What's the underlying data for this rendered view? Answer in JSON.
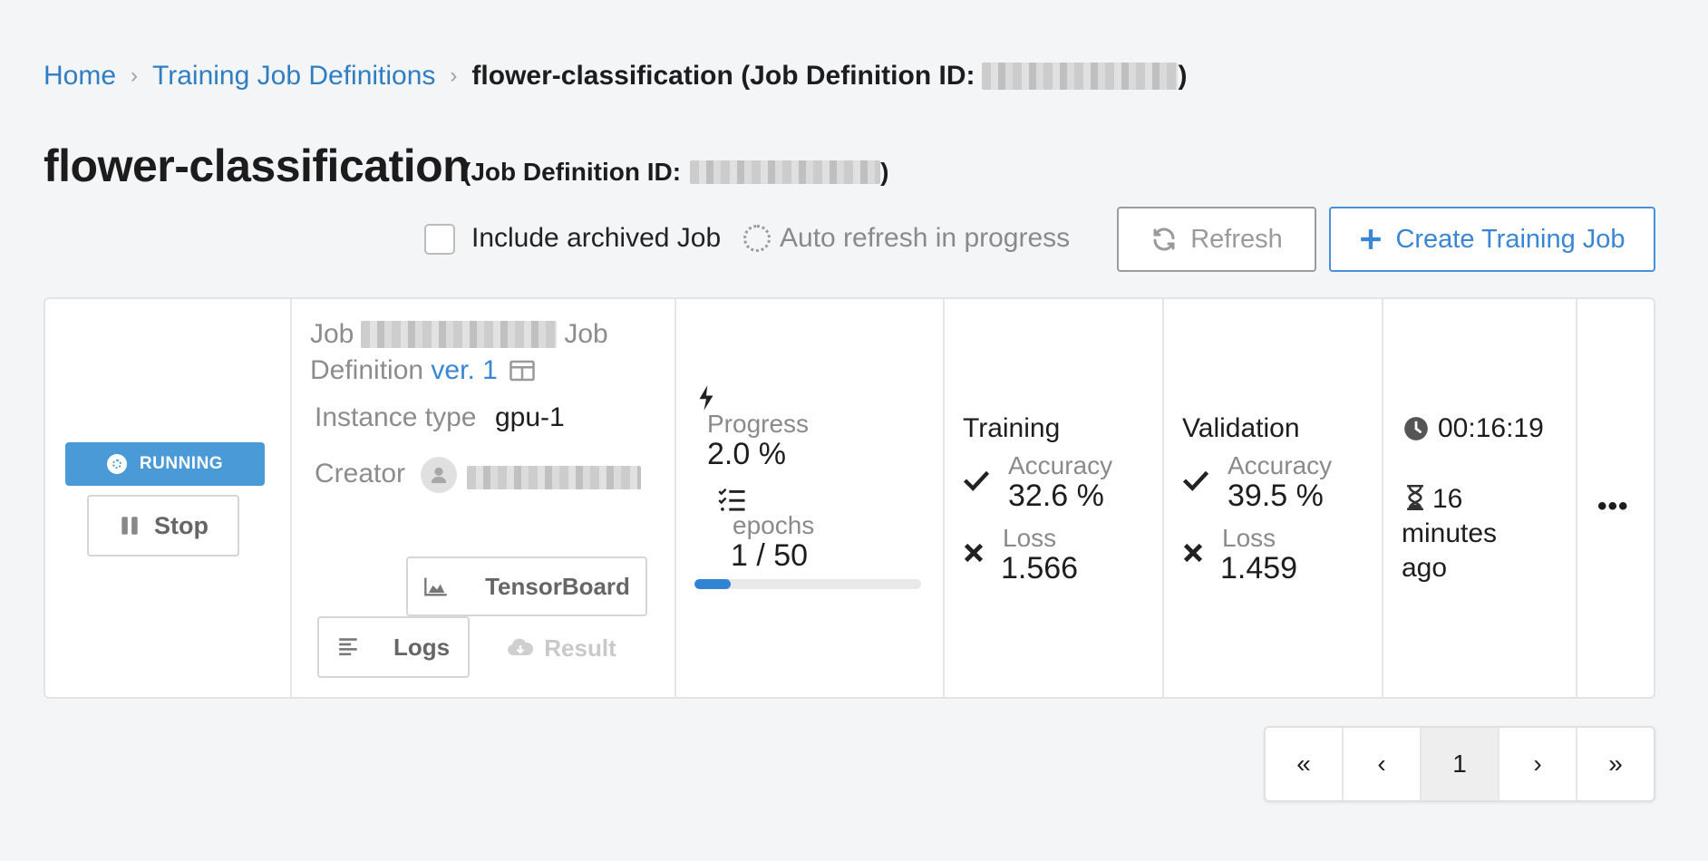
{
  "breadcrumb": {
    "home": "Home",
    "definitions": "Training Job Definitions",
    "current_name": "flower-classification",
    "current_id_prefix": "(Job Definition ID:",
    "current_id_suffix": ")"
  },
  "page": {
    "title": "flower-classification",
    "id_prefix": "(Job Definition ID:",
    "id_suffix": ")"
  },
  "toolbar": {
    "include_archived_label": "Include archived Job",
    "auto_refresh_label": "Auto refresh in progress",
    "refresh_label": "Refresh",
    "create_label": "Create Training Job"
  },
  "job": {
    "status": "RUNNING",
    "stop_label": "Stop",
    "job_prefix": "Job",
    "job_suffix": "Job",
    "definition_label": "Definition",
    "version_label": "ver. 1",
    "instance_type_label": "Instance type",
    "instance_type_value": "gpu-1",
    "creator_label": "Creator",
    "tensorboard_label": "TensorBoard",
    "logs_label": "Logs",
    "result_label": "Result",
    "progress_label": "Progress",
    "progress_value": "2.0 %",
    "progress_fraction": 0.02,
    "epochs_label": "epochs",
    "epochs_value": "1 / 50",
    "training": {
      "title": "Training",
      "accuracy_label": "Accuracy",
      "accuracy_value": "32.6 %",
      "loss_label": "Loss",
      "loss_value": "1.566"
    },
    "validation": {
      "title": "Validation",
      "accuracy_label": "Accuracy",
      "accuracy_value": "39.5 %",
      "loss_label": "Loss",
      "loss_value": "1.459"
    },
    "elapsed": "00:16:19",
    "started_ago": "16 minutes ago",
    "more_label": "•••"
  },
  "pagination": {
    "first": "«",
    "prev": "‹",
    "current": "1",
    "next": "›",
    "last": "»"
  },
  "colors": {
    "accent": "#3a86d4",
    "running_badge": "#4a9ad8",
    "progress_fill": "#2f84d3",
    "background": "#f4f5f7"
  }
}
